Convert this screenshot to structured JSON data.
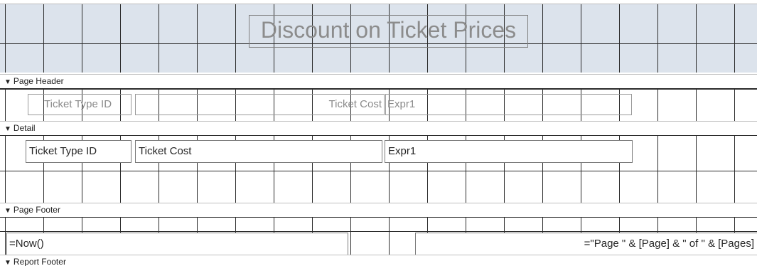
{
  "report_header": {
    "title": "Discount on Ticket Prices",
    "background": "#dce3ec"
  },
  "sections": {
    "page_header": "Page Header",
    "detail": "Detail",
    "page_footer": "Page Footer",
    "report_footer": "Report Footer"
  },
  "page_header_labels": {
    "ticket_type_id": "Ticket Type ID",
    "ticket_cost": "Ticket Cost",
    "expr1": "Expr1"
  },
  "detail_fields": {
    "ticket_type_id": "Ticket Type ID",
    "ticket_cost": "Ticket Cost",
    "expr1": "Expr1"
  },
  "page_footer_fields": {
    "now": "=Now()",
    "page_expr": "=\"Page \" & [Page] & \" of \" & [Pages]"
  },
  "icons": {
    "section_arrow": "section-collapse-arrow-icon"
  }
}
